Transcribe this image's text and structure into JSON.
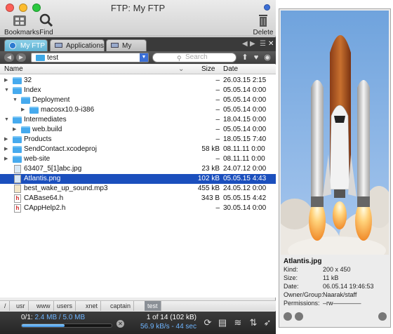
{
  "window": {
    "title": "FTP: My FTP",
    "toolbar": {
      "bookmarks": "Bookmarks",
      "find": "Find",
      "delete": "Delete"
    }
  },
  "tabs": [
    {
      "label": "My FTP",
      "active": true
    },
    {
      "label": "Applications",
      "active": false
    },
    {
      "label": "My Mac",
      "active": false
    }
  ],
  "pathbar": {
    "current": "test",
    "search_placeholder": "Search"
  },
  "columns": {
    "name": "Name",
    "size": "Size",
    "date": "Date"
  },
  "files": [
    {
      "name": "32",
      "size": "–",
      "date": "26.03.15 2:15",
      "kind": "folder",
      "indent": 0,
      "expanded": false,
      "selected": false
    },
    {
      "name": "Index",
      "size": "–",
      "date": "05.05.14 0:00",
      "kind": "folder",
      "indent": 0,
      "expanded": true,
      "selected": false
    },
    {
      "name": "Deployment",
      "size": "–",
      "date": "05.05.14 0:00",
      "kind": "folder",
      "indent": 1,
      "expanded": true,
      "selected": false
    },
    {
      "name": "macosx10.9-i386",
      "size": "–",
      "date": "05.05.14 0:00",
      "kind": "folder",
      "indent": 2,
      "expanded": false,
      "selected": false
    },
    {
      "name": "Intermediates",
      "size": "–",
      "date": "18.04.15 0:00",
      "kind": "folder",
      "indent": 0,
      "expanded": true,
      "selected": false
    },
    {
      "name": "web.build",
      "size": "–",
      "date": "05.05.14 0:00",
      "kind": "folder",
      "indent": 1,
      "expanded": false,
      "selected": false
    },
    {
      "name": "Products",
      "size": "–",
      "date": "18.05.15 7:40",
      "kind": "folder",
      "indent": 0,
      "expanded": false,
      "selected": false
    },
    {
      "name": "SendContact.xcodeproj",
      "size": "58 kB",
      "date": "08.11.11 0:00",
      "kind": "folder",
      "indent": 0,
      "expanded": false,
      "selected": false
    },
    {
      "name": "web-site",
      "size": "–",
      "date": "08.11.11 0:00",
      "kind": "folder",
      "indent": 0,
      "expanded": false,
      "selected": false
    },
    {
      "name": "63407_5[1]abc.jpg",
      "size": "23 kB",
      "date": "24.07.12 0:00",
      "kind": "img",
      "indent": 0,
      "selected": false
    },
    {
      "name": "Atlantis.png",
      "size": "102 kB",
      "date": "05.05.15 4:43",
      "kind": "img",
      "indent": 0,
      "selected": true
    },
    {
      "name": "best_wake_up_sound.mp3",
      "size": "455 kB",
      "date": "24.05.12 0:00",
      "kind": "mp3",
      "indent": 0,
      "selected": false
    },
    {
      "name": "CABase64.h",
      "size": "343 B",
      "date": "05.05.15 4:42",
      "kind": "h",
      "indent": 0,
      "selected": false
    },
    {
      "name": "CAppHelp2.h",
      "size": "–",
      "date": "30.05.14 0:00",
      "kind": "h",
      "indent": 0,
      "selected": false
    }
  ],
  "breadcrumb": [
    "/",
    "usr",
    "www",
    "users",
    "xnet",
    "captain",
    "test"
  ],
  "status": {
    "transfer_prefix": "0/1: ",
    "transfer_amount": "2.4 MB / 5.0 MB",
    "progress": 0.48,
    "count": "1 of 14 (102 kB)",
    "speed": "56.9 kB/s - 44 sec"
  },
  "preview": {
    "filename": "Atlantis.jpg",
    "info": [
      {
        "key": "Kind:",
        "value": "200 x 450"
      },
      {
        "key": "Size:",
        "value": "11 kB"
      },
      {
        "key": "Date:",
        "value": "06.05.14 19:46:53"
      },
      {
        "key": "Owner/Group:",
        "value": "Naarak/staff"
      },
      {
        "key": "Permissions:",
        "value": "–rw––––––––"
      }
    ]
  }
}
